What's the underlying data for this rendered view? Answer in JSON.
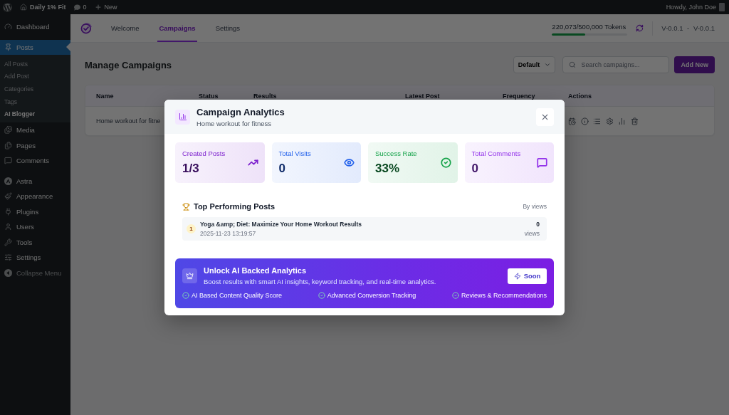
{
  "admin_bar": {
    "site_name": "Daily 1% Fit",
    "comments_count": "0",
    "new_label": "New",
    "greeting": "Howdy, John Doe"
  },
  "sidebar": {
    "sections": [
      {
        "items": [
          {
            "label": "Dashboard",
            "selected": false
          }
        ]
      },
      {
        "items": [
          {
            "label": "Posts",
            "selected": true,
            "children": [
              {
                "label": "All Posts",
                "selected": false
              },
              {
                "label": "Add Post",
                "selected": false
              },
              {
                "label": "Categories",
                "selected": false
              },
              {
                "label": "Tags",
                "selected": false
              },
              {
                "label": "AI Blogger",
                "selected": true
              }
            ]
          },
          {
            "label": "Media",
            "selected": false
          },
          {
            "label": "Pages",
            "selected": false
          },
          {
            "label": "Comments",
            "selected": false
          }
        ]
      },
      {
        "items": [
          {
            "label": "Astra",
            "selected": false
          },
          {
            "label": "Appearance",
            "selected": false
          },
          {
            "label": "Plugins",
            "selected": false
          },
          {
            "label": "Users",
            "selected": false
          },
          {
            "label": "Tools",
            "selected": false
          },
          {
            "label": "Settings",
            "selected": false
          }
        ]
      }
    ],
    "collapse_label": "Collapse Menu"
  },
  "plugin_header": {
    "tabs": [
      {
        "label": "Welcome",
        "selected": false
      },
      {
        "label": "Campaigns",
        "selected": true
      },
      {
        "label": "Settings",
        "selected": false
      }
    ],
    "tokens": {
      "label": "220,073/500,000 Tokens",
      "level": 0.44
    },
    "version": "V-0.0.1 - V-0.0.1"
  },
  "page": {
    "title": "Manage Campaigns",
    "sort_select": {
      "value": "Default"
    },
    "search": {
      "placeholder": "Search campaigns..."
    },
    "add_button": "Add New"
  },
  "table": {
    "columns": [
      "Name",
      "Status",
      "Results",
      "Latest Post",
      "Frequency",
      "Actions"
    ],
    "rows": [
      {
        "name": "Home workout for fitne"
      }
    ]
  },
  "modal": {
    "title": "Campaign Analytics",
    "subtitle": "Home workout for fitness",
    "stats": [
      {
        "label": "Created Posts",
        "value": "1/3",
        "color": "#7e22ce"
      },
      {
        "label": "Total Visits",
        "value": "0",
        "color": "#2563eb"
      },
      {
        "label": "Success Rate",
        "value": "33%",
        "color": "#16a34a"
      },
      {
        "label": "Total Comments",
        "value": "0",
        "color": "#9333ea"
      }
    ],
    "top_posts": {
      "title": "Top Performing Posts",
      "sort_label": "By views",
      "posts": [
        {
          "rank": "1",
          "title": "Yoga &amp; Diet: Maximize Your Home Workout Results",
          "date": "2025-11-23 13:19:57",
          "views": "0",
          "views_label": "views"
        }
      ]
    },
    "upsell": {
      "title": "Unlock AI Backed Analytics",
      "description": "Boost results with smart AI insights, keyword tracking, and real-time analytics.",
      "button": "Soon",
      "features": [
        "AI Based Content Quality Score",
        "Advanced Conversion Tracking",
        "Reviews & Recommendations"
      ]
    }
  }
}
